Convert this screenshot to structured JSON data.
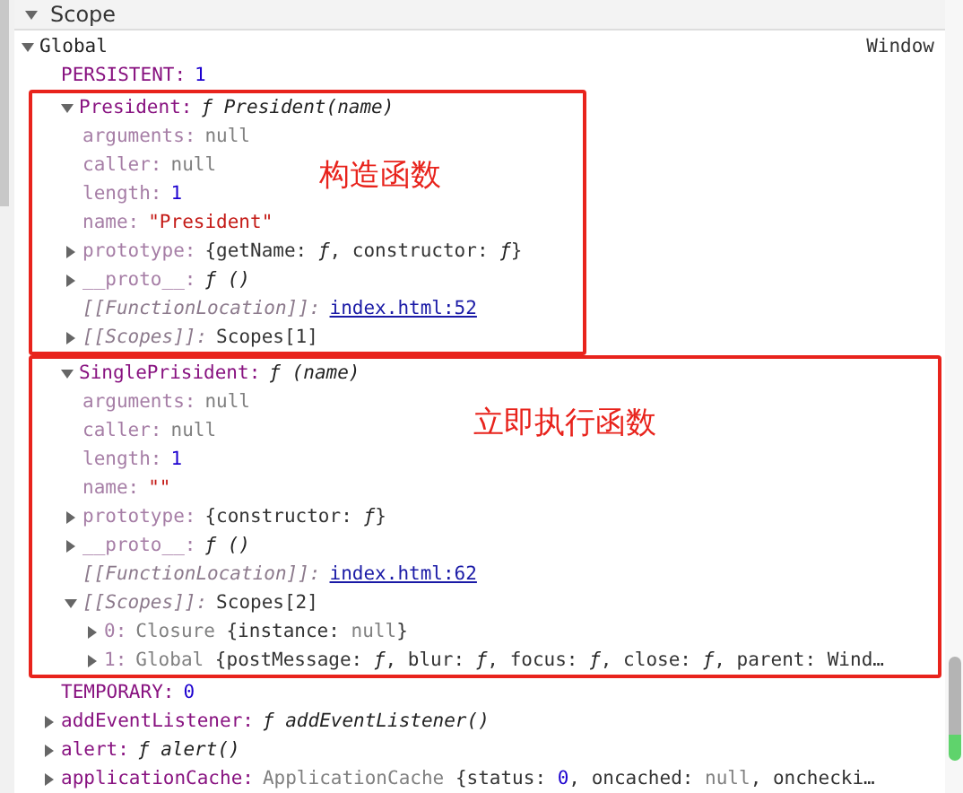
{
  "section": {
    "title": "Scope",
    "expanded": true
  },
  "tree": [
    {
      "key": "Global",
      "kind": "scope",
      "expanded": true,
      "value": [
        {
          "kind": "plain",
          "text": "Window"
        }
      ],
      "children": [
        {
          "key": "PERSISTENT:",
          "kind": "own",
          "value": [
            {
              "kind": "number",
              "text": "1"
            }
          ]
        },
        {
          "kind": "group",
          "label": "构造函数",
          "children": [
            {
              "key": "President:",
              "kind": "own",
              "expanded": true,
              "value": [
                {
                  "kind": "func",
                  "text": "ƒ President(name)"
                }
              ],
              "children": [
                {
                  "key": "arguments:",
                  "kind": "dim",
                  "value": [
                    {
                      "kind": "null",
                      "text": "null"
                    }
                  ]
                },
                {
                  "key": "caller:",
                  "kind": "dim",
                  "value": [
                    {
                      "kind": "null",
                      "text": "null"
                    }
                  ]
                },
                {
                  "key": "length:",
                  "kind": "dim",
                  "value": [
                    {
                      "kind": "number",
                      "text": "1"
                    }
                  ]
                },
                {
                  "key": "name:",
                  "kind": "dim",
                  "value": [
                    {
                      "kind": "string",
                      "text": "\"President\""
                    }
                  ]
                },
                {
                  "key": "prototype:",
                  "kind": "dim",
                  "expanded": false,
                  "value": [
                    {
                      "kind": "plain",
                      "text": "{getName: "
                    },
                    {
                      "kind": "func",
                      "text": "ƒ"
                    },
                    {
                      "kind": "plain",
                      "text": ", constructor: "
                    },
                    {
                      "kind": "func",
                      "text": "ƒ"
                    },
                    {
                      "kind": "plain",
                      "text": "}"
                    }
                  ]
                },
                {
                  "key": "__proto__:",
                  "kind": "dim",
                  "expanded": false,
                  "value": [
                    {
                      "kind": "func",
                      "text": "ƒ ()"
                    }
                  ]
                },
                {
                  "key": "[[FunctionLocation]]:",
                  "kind": "internal",
                  "value": [
                    {
                      "kind": "link",
                      "text": "index.html:52"
                    }
                  ]
                },
                {
                  "key": "[[Scopes]]:",
                  "kind": "internal",
                  "expanded": false,
                  "value": [
                    {
                      "kind": "plain",
                      "text": "Scopes[1]"
                    }
                  ]
                }
              ]
            }
          ]
        },
        {
          "kind": "group",
          "label": "立即执行函数",
          "children": [
            {
              "key": "SinglePrisident:",
              "kind": "own",
              "expanded": true,
              "value": [
                {
                  "kind": "func",
                  "text": "ƒ (name)"
                }
              ],
              "children": [
                {
                  "key": "arguments:",
                  "kind": "dim",
                  "value": [
                    {
                      "kind": "null",
                      "text": "null"
                    }
                  ]
                },
                {
                  "key": "caller:",
                  "kind": "dim",
                  "value": [
                    {
                      "kind": "null",
                      "text": "null"
                    }
                  ]
                },
                {
                  "key": "length:",
                  "kind": "dim",
                  "value": [
                    {
                      "kind": "number",
                      "text": "1"
                    }
                  ]
                },
                {
                  "key": "name:",
                  "kind": "dim",
                  "value": [
                    {
                      "kind": "string",
                      "text": "\"\""
                    }
                  ]
                },
                {
                  "key": "prototype:",
                  "kind": "dim",
                  "expanded": false,
                  "value": [
                    {
                      "kind": "plain",
                      "text": "{constructor: "
                    },
                    {
                      "kind": "func",
                      "text": "ƒ"
                    },
                    {
                      "kind": "plain",
                      "text": "}"
                    }
                  ]
                },
                {
                  "key": "__proto__:",
                  "kind": "dim",
                  "expanded": false,
                  "value": [
                    {
                      "kind": "func",
                      "text": "ƒ ()"
                    }
                  ]
                },
                {
                  "key": "[[FunctionLocation]]:",
                  "kind": "internal",
                  "value": [
                    {
                      "kind": "link",
                      "text": "index.html:62"
                    }
                  ]
                },
                {
                  "key": "[[Scopes]]:",
                  "kind": "internal",
                  "expanded": true,
                  "value": [
                    {
                      "kind": "plain",
                      "text": "Scopes[2]"
                    }
                  ],
                  "children": [
                    {
                      "key": "0:",
                      "kind": "dim",
                      "expanded": false,
                      "value": [
                        {
                          "kind": "null",
                          "text": "Closure "
                        },
                        {
                          "kind": "plain",
                          "text": "{instance: "
                        },
                        {
                          "kind": "null",
                          "text": "null"
                        },
                        {
                          "kind": "plain",
                          "text": "}"
                        }
                      ]
                    },
                    {
                      "key": "1:",
                      "kind": "dim",
                      "expanded": false,
                      "value": [
                        {
                          "kind": "null",
                          "text": "Global "
                        },
                        {
                          "kind": "plain",
                          "text": "{postMessage: "
                        },
                        {
                          "kind": "func",
                          "text": "ƒ"
                        },
                        {
                          "kind": "plain",
                          "text": ", blur: "
                        },
                        {
                          "kind": "func",
                          "text": "ƒ"
                        },
                        {
                          "kind": "plain",
                          "text": ", focus: "
                        },
                        {
                          "kind": "func",
                          "text": "ƒ"
                        },
                        {
                          "kind": "plain",
                          "text": ", close: "
                        },
                        {
                          "kind": "func",
                          "text": "ƒ"
                        },
                        {
                          "kind": "plain",
                          "text": ", parent: Wind…"
                        }
                      ]
                    }
                  ]
                }
              ]
            }
          ]
        },
        {
          "key": "TEMPORARY:",
          "kind": "own",
          "value": [
            {
              "kind": "number",
              "text": "0"
            }
          ]
        },
        {
          "key": "addEventListener:",
          "kind": "own",
          "expanded": false,
          "value": [
            {
              "kind": "func",
              "text": "ƒ addEventListener()"
            }
          ]
        },
        {
          "key": "alert:",
          "kind": "own",
          "expanded": false,
          "value": [
            {
              "kind": "func",
              "text": "ƒ alert()"
            }
          ]
        },
        {
          "key": "applicationCache:",
          "kind": "own",
          "expanded": false,
          "value": [
            {
              "kind": "null",
              "text": "ApplicationCache "
            },
            {
              "kind": "plain",
              "text": "{status: "
            },
            {
              "kind": "number",
              "text": "0"
            },
            {
              "kind": "plain",
              "text": ", oncached: "
            },
            {
              "kind": "null",
              "text": "null"
            },
            {
              "kind": "plain",
              "text": ", onchecki…"
            }
          ]
        }
      ]
    }
  ]
}
